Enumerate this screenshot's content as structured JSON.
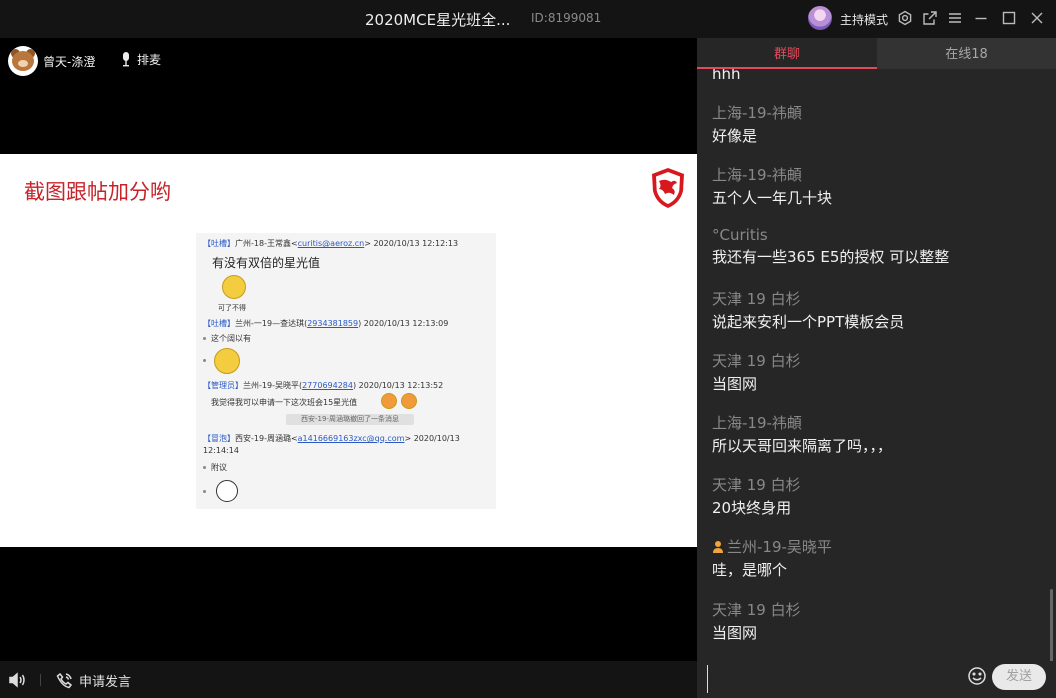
{
  "window": {
    "title": "2020MCE星光班全...",
    "room_id": "ID:8199081",
    "host_mode_label": "主持模式"
  },
  "presenter": {
    "name": "曾天-涤澄",
    "queue_label": "排麦"
  },
  "slide": {
    "title": "截图跟帖加分哟",
    "screenshot": {
      "messages": [
        {
          "role": "【吐槽】",
          "sender": "广州-18-王常鑫",
          "email": "curitis@aeroz.cn",
          "time": "2020/10/13 12:12:13",
          "text": "有没有双倍的星光值",
          "sticker_caption": "可了不得"
        },
        {
          "role": "【吐槽】",
          "sender": "兰州-一19—查达琪",
          "email": "2934381859",
          "time": "2020/10/13 12:13:09",
          "text": "这个阔以有"
        },
        {
          "role": "【管理员】",
          "sender": "兰州-19-吴晓平",
          "email": "2770694284",
          "time": "2020/10/13 12:13:52",
          "text": "我觉得我可以申请一下这次班会15星光值"
        },
        {
          "recall": "西安-19-周涵璐撤回了一条消息"
        },
        {
          "role": "【冒泡】",
          "sender": "西安-19-周涵璐",
          "email": "a1416669163zxc@qq.com",
          "time": "2020/10/13",
          "time2": "12:14:14",
          "text": "附议"
        }
      ]
    }
  },
  "bottombar": {
    "apply_speak_label": "申请发言"
  },
  "chat": {
    "tabs": [
      {
        "label": "群聊",
        "active": true
      },
      {
        "label": "在线18",
        "active": false
      }
    ],
    "partial_top_text": "hhh",
    "messages": [
      {
        "sender": "上海-19-祎頔",
        "text": "好像是"
      },
      {
        "sender": "上海-19-祎頔",
        "text": "五个人一年几十块"
      },
      {
        "sender": "°Curitis",
        "text": "我还有一些365 E5的授权 可以整整"
      },
      {
        "sender": "天津 19 白杉",
        "text": "说起来安利一个PPT模板会员"
      },
      {
        "sender": "天津 19 白杉",
        "text": "当图网"
      },
      {
        "sender": "上海-19-祎頔",
        "text": "所以天哥回来隔离了吗，，，"
      },
      {
        "sender": "天津 19 白杉",
        "text": "20块终身用"
      },
      {
        "sender": "兰州-19-吴晓平",
        "text": "哇，是哪个",
        "admin": true
      },
      {
        "sender": "天津 19 白杉",
        "text": "当图网"
      }
    ],
    "input_value": "",
    "send_label": "发送"
  },
  "colors": {
    "accent": "#e24a59",
    "slide_title": "#c6232b",
    "chat_bg": "#262626"
  }
}
